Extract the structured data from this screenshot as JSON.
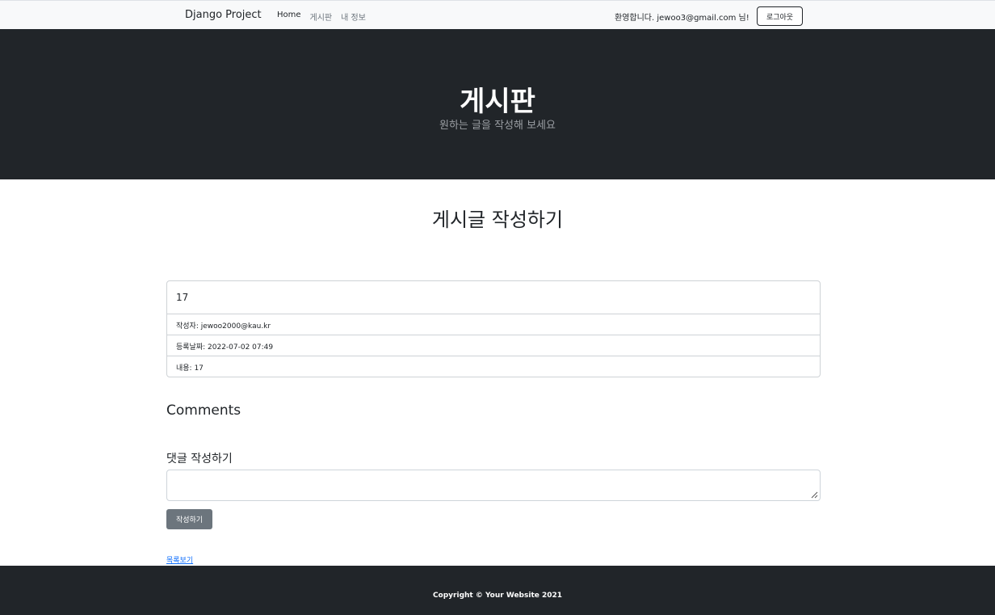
{
  "navbar": {
    "brand": "Django Project",
    "links": [
      {
        "label": "Home",
        "active": true
      },
      {
        "label": "게시판",
        "active": false
      },
      {
        "label": "내 정보",
        "active": false
      }
    ],
    "welcome": "환영합니다. jewoo3@gmail.com 님!",
    "logout_label": "로그아웃"
  },
  "header": {
    "title": "게시판",
    "subtitle": "원하는 글을 작성해 보세요"
  },
  "main": {
    "page_title": "게시글 작성하기",
    "post": {
      "title": "17",
      "author": "작성자: jewoo2000@kau.kr",
      "date": "등록날짜: 2022-07-02 07:49",
      "content": "내용: 17"
    },
    "comments_heading": "Comments",
    "comment_form": {
      "label": "댓글 작성하기",
      "value": "",
      "submit_label": "작성하기"
    },
    "list_link": "목록보기"
  },
  "footer": {
    "copyright": "Copyright © Your Website 2021"
  },
  "colors": {
    "navbar_bg": "#f8f9fa",
    "dark": "#212529",
    "secondary_button": "#6c757d",
    "link": "#0d6efd"
  }
}
